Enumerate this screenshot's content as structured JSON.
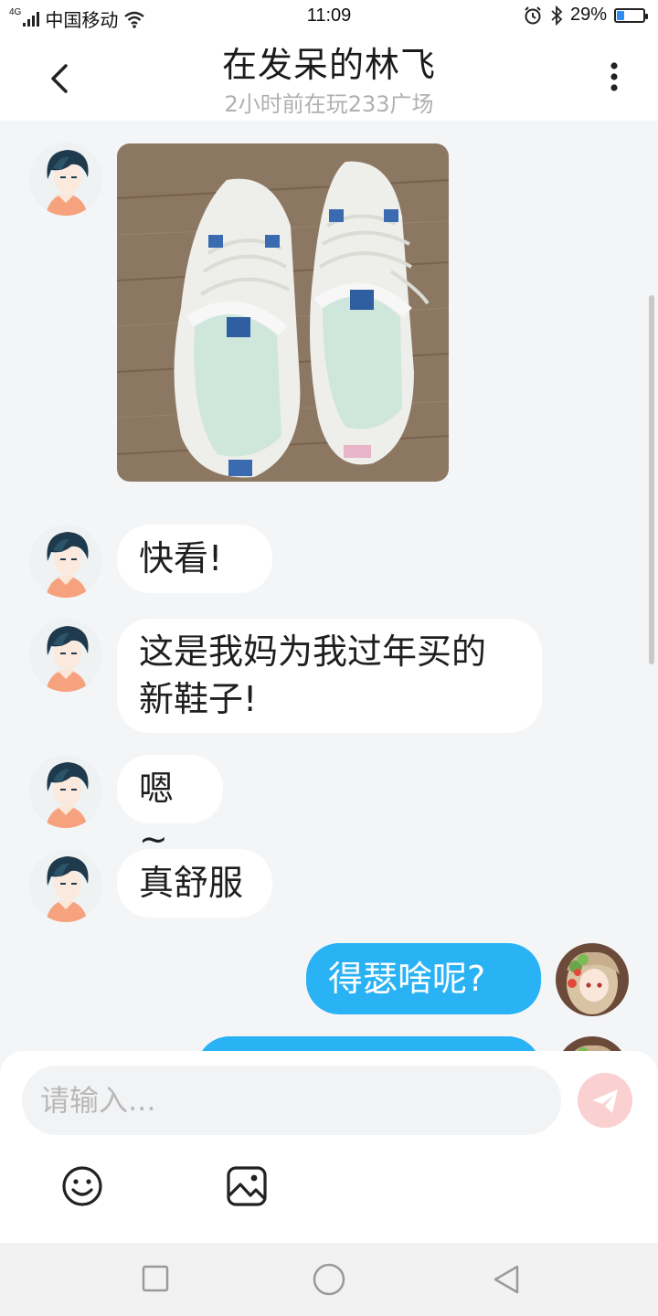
{
  "status_bar": {
    "network_type": "4G",
    "carrier": "中国移动",
    "time": "11:09",
    "battery_percent": "29%",
    "battery_level": 0.29,
    "icons": [
      "signal-icon",
      "wifi-icon",
      "alarm-icon",
      "bluetooth-icon",
      "battery-icon"
    ]
  },
  "header": {
    "title": "在发呆的林飞",
    "subtitle": "2小时前在玩233广场",
    "icons": [
      "back-arrow-icon",
      "more-vertical-icon"
    ]
  },
  "messages": [
    {
      "sender": "other",
      "type": "image",
      "content": "white sneakers photo"
    },
    {
      "sender": "other",
      "type": "text",
      "lines": [
        "快看!"
      ]
    },
    {
      "sender": "other",
      "type": "text",
      "lines": [
        "这是我妈为我过年买的",
        "新鞋子!"
      ]
    },
    {
      "sender": "other",
      "type": "text",
      "lines": [
        "嗯~"
      ]
    },
    {
      "sender": "other",
      "type": "text",
      "lines": [
        "真舒服"
      ]
    },
    {
      "sender": "me",
      "type": "text",
      "lines": [
        "得瑟啥呢?"
      ]
    }
  ],
  "composer": {
    "placeholder": "请输入...",
    "icons": [
      "send-icon",
      "emoji-icon",
      "image-icon"
    ],
    "send_color": "#f7a7a7"
  },
  "nav_bar": {
    "icons": [
      "recent-apps-icon",
      "home-icon",
      "back-icon"
    ]
  },
  "colors": {
    "my_bubble": "#29b2f4",
    "other_bubble": "#ffffff",
    "background": "#f4f5f7"
  }
}
